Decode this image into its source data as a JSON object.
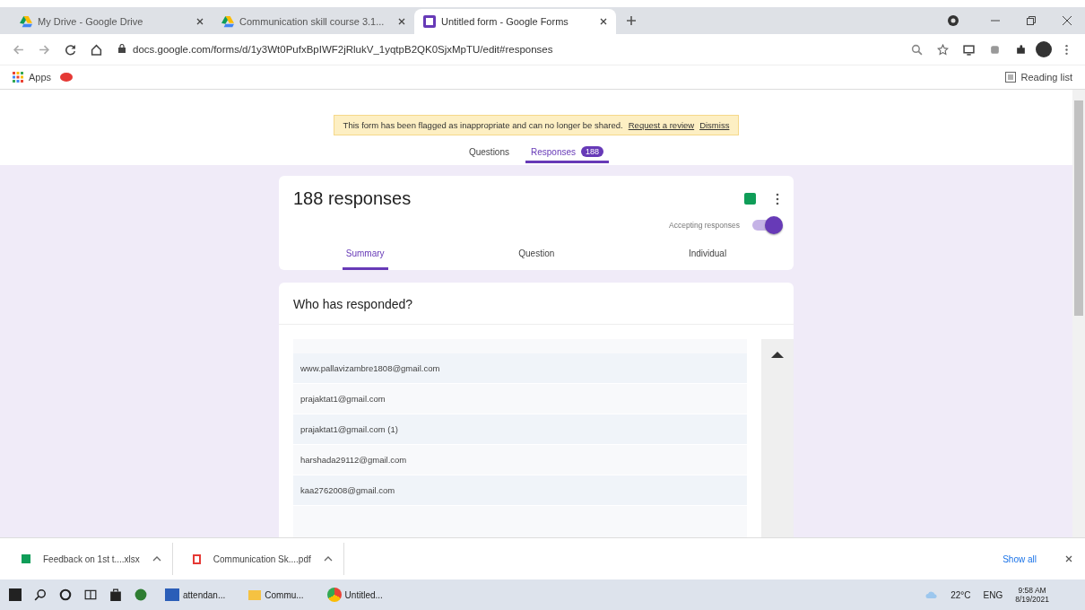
{
  "browser_tabs": [
    {
      "title": "My Drive - Google Drive",
      "selected": false
    },
    {
      "title": "Communication skill course 3.1...",
      "selected": false
    },
    {
      "title": "Untitled form - Google Forms",
      "selected": true
    }
  ],
  "address_bar": {
    "url": "docs.google.com/forms/d/1y3Wt0PufxBpIWF2jRlukV_1yqtpB2QK0SjxMpTU/edit#responses"
  },
  "bookmarks": [
    {
      "label": "Apps"
    }
  ],
  "reading_list": "Reading list",
  "banner": {
    "message": "This form has been flagged as inappropriate and can no longer be shared.",
    "links": [
      "Request a review",
      "Dismiss"
    ]
  },
  "form_tabs": [
    {
      "label": "Questions",
      "selected": false
    },
    {
      "label": "Responses",
      "selected": true,
      "badge": "188"
    }
  ],
  "responses": {
    "title": "188 responses",
    "accepting_label": "Accepting responses",
    "accepting": true,
    "view_tabs": [
      {
        "label": "Summary",
        "selected": true
      },
      {
        "label": "Question",
        "selected": false
      },
      {
        "label": "Individual",
        "selected": false
      }
    ]
  },
  "who_responded": {
    "title": "Who has responded?",
    "emails": [
      "www.pallavizambre1808@gmail.com",
      "prajaktat1@gmail.com",
      "prajaktat1@gmail.com (1)",
      "harshada29112@gmail.com",
      "kaa2762008@gmail.com"
    ]
  },
  "downloads": [
    {
      "name": "Feedback on 1st t....xlsx",
      "kind": "sheet"
    },
    {
      "name": "Communication Sk....pdf",
      "kind": "pdf"
    }
  ],
  "show_all": "Show all",
  "taskbar": {
    "apps": [
      {
        "label": "attendan...",
        "kind": "word"
      },
      {
        "label": "Commu...",
        "kind": "folder"
      },
      {
        "label": "Untitled...",
        "kind": "chrome"
      }
    ],
    "temperature": "22°C",
    "language": "ENG",
    "time": "9:58 AM",
    "date": "8/19/2021"
  }
}
